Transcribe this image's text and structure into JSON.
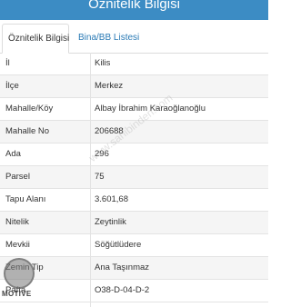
{
  "header": {
    "title": "Öznitelik Bilgisi"
  },
  "tabs": [
    {
      "label": "Öznitelik Bilgisi",
      "active": true
    },
    {
      "label": "Bina/BB Listesi",
      "active": false
    }
  ],
  "attributes": [
    {
      "label": "İl",
      "value": "Kilis"
    },
    {
      "label": "İlçe",
      "value": "Merkez"
    },
    {
      "label": "Mahalle/Köy",
      "value": "Albay İbrahim Karaoğlanoğlu"
    },
    {
      "label": "Mahalle No",
      "value": "206688"
    },
    {
      "label": "Ada",
      "value": "296"
    },
    {
      "label": "Parsel",
      "value": "75"
    },
    {
      "label": "Tapu Alanı",
      "value": "3.601,68"
    },
    {
      "label": "Nitelik",
      "value": "Zeytinlik"
    },
    {
      "label": "Mevkii",
      "value": "Söğütlüdere"
    },
    {
      "label": "Zemin Tip",
      "value": "Ana Taşınmaz"
    },
    {
      "label": "Pafta",
      "value": "O38-D-04-D-2"
    }
  ],
  "watermark": {
    "text": "www.sahibinden.com"
  },
  "logo": {
    "text": "MOTIVE",
    "icon": "motive-logo-icon"
  },
  "colors": {
    "header_bg": "#3c8cc4",
    "tab_link": "#2a7ab5",
    "row_alt": "#f5f5f5"
  }
}
